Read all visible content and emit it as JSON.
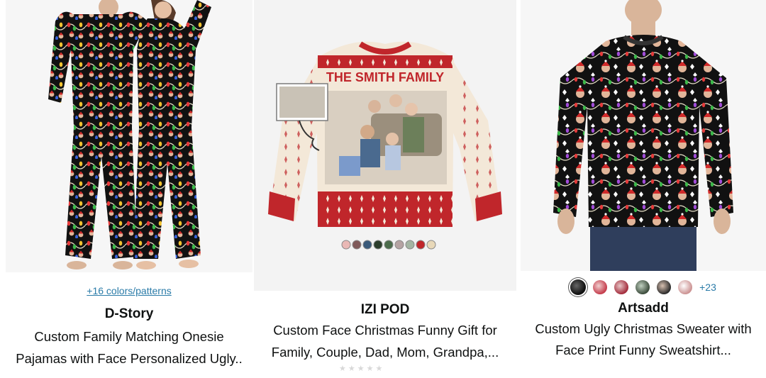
{
  "products": [
    {
      "colors_link": "+16 colors/patterns",
      "brand": "D-Story",
      "title_line1": "Custom Family Matching Onesie",
      "title_line2": "Pajamas with Face Personalized Ugly.."
    },
    {
      "image_text": "THE SMITH FAMILY",
      "brand": "IZI POD",
      "title_line1": "Custom Face Christmas Funny Gift for",
      "title_line2": "Family, Couple, Dad, Mom, Grandpa,..."
    },
    {
      "more_swatches": "+23",
      "brand": "Artsadd",
      "title_line1": "Custom Ugly Christmas Sweater with",
      "title_line2": "Face Print Funny Sweatshirt..."
    }
  ],
  "colors": {
    "link": "#2a7ba8",
    "sweater_red": "#c0262b"
  }
}
